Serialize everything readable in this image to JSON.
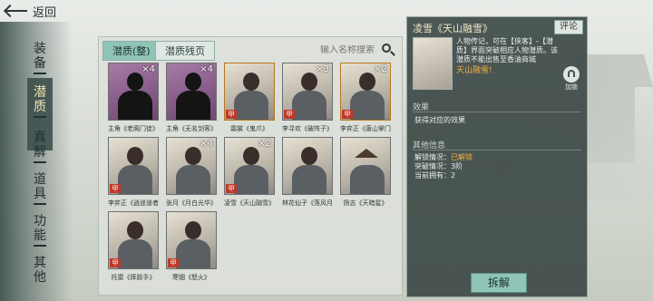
{
  "topbar": {
    "back_label": "返回"
  },
  "sidenav": {
    "items": [
      {
        "label": "装备"
      },
      {
        "label": "潜质"
      },
      {
        "label": "真解"
      },
      {
        "label": "道具"
      },
      {
        "label": "功能"
      },
      {
        "label": "其他"
      }
    ],
    "active_index": 1
  },
  "tabs": [
    {
      "label": "潜质(整)",
      "active": true
    },
    {
      "label": "潜质残页",
      "active": false
    }
  ],
  "search": {
    "placeholder": "输入名称搜索"
  },
  "cards": [
    {
      "name": "主角《老阁门徒》",
      "count": "×4",
      "silhouette": true,
      "badge": ""
    },
    {
      "name": "主角《无名剑客》",
      "count": "×4",
      "silhouette": true,
      "badge": ""
    },
    {
      "name": "霜裳《鬼爪》",
      "count": "",
      "silhouette": false,
      "badge": "甲"
    },
    {
      "name": "李寻欢《破阵子》",
      "count": "×3",
      "silhouette": false,
      "badge": "甲"
    },
    {
      "name": "李弈正《唐山掌门》",
      "count": "×2",
      "silhouette": false,
      "badge": "甲"
    },
    {
      "name": "李弈正《逍遥道者》",
      "count": "",
      "silhouette": false,
      "badge": "甲"
    },
    {
      "name": "张月《月白光华》",
      "count": "×4",
      "silhouette": false,
      "badge": ""
    },
    {
      "name": "凌雪《天山融雪》",
      "count": "×2",
      "silhouette": false,
      "badge": "甲"
    },
    {
      "name": "林花仙子《落风月情》",
      "count": "",
      "silhouette": false,
      "badge": ""
    },
    {
      "name": "扬志《天暗星》",
      "count": "",
      "silhouette": false,
      "badge": "",
      "hat": true
    },
    {
      "name": "托雷《摔跤手》",
      "count": "",
      "silhouette": false,
      "badge": "甲"
    },
    {
      "name": "寒烟《怒火》",
      "count": "",
      "silhouette": false,
      "badge": "甲"
    }
  ],
  "detail": {
    "title": "凌雪《天山融雪》",
    "review_label": "评论",
    "description": "人物传记，可在【侠客】-【潜质】界面突破相应人物潜质。该潜质不能出售至香油商城",
    "potential_name": "天山融雪!",
    "lock_label": "加锁",
    "effect_title": "效果",
    "effect_text": "获得对应的效果",
    "other_title": "其他信息",
    "unlock_status_label": "解锁情况：",
    "unlock_status_value": "已解锁",
    "breakthrough_label": "突破情况：",
    "breakthrough_value": "3阶",
    "owned_label": "当前拥有：",
    "owned_value": "2",
    "dismantle_label": "拆解"
  }
}
